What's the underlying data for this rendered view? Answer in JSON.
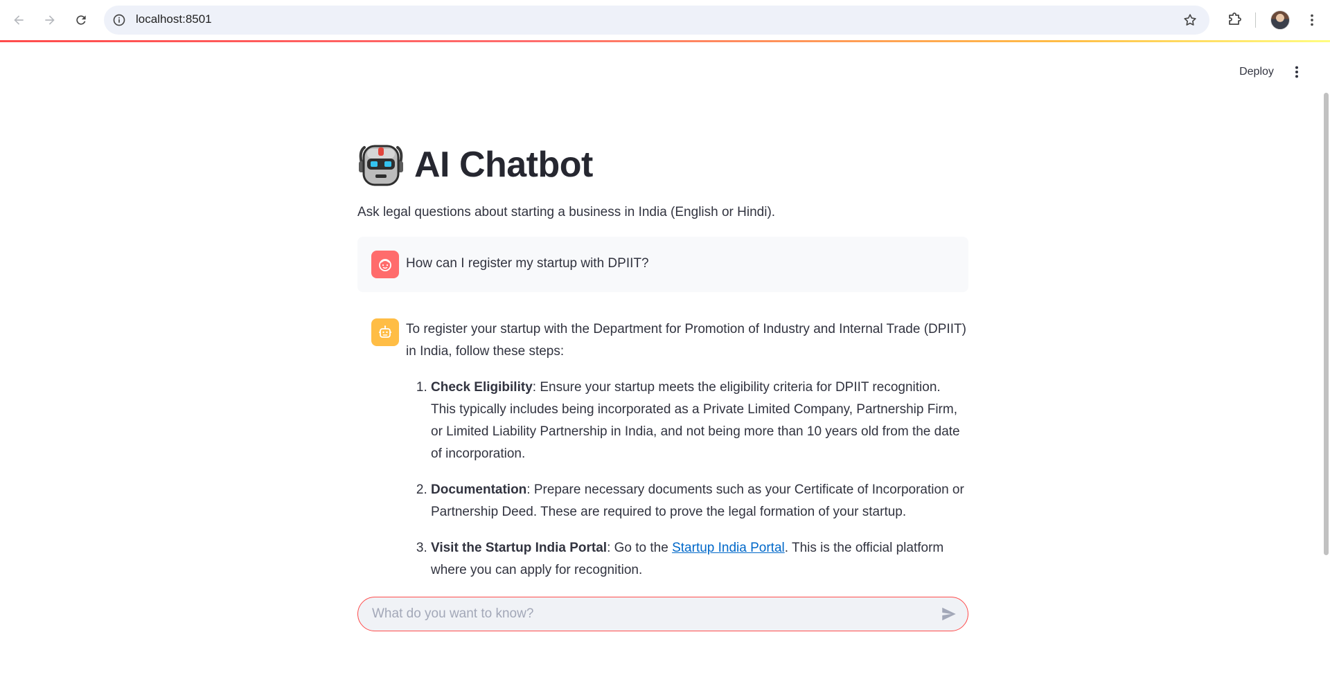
{
  "browser": {
    "url": "localhost:8501"
  },
  "header": {
    "deploy_label": "Deploy"
  },
  "app": {
    "title": "AI Chatbot",
    "subtitle": "Ask legal questions about starting a business in India (English or Hindi).",
    "title_icon": "robot-emoji"
  },
  "chat": {
    "user_message": "How can I register my startup with DPIIT?",
    "assistant": {
      "intro": "To register your startup with the Department for Promotion of Industry and Internal Trade (DPIIT) in India, follow these steps:",
      "steps": [
        {
          "number": "1.",
          "title": "Check Eligibility",
          "text": ": Ensure your startup meets the eligibility criteria for DPIIT recognition. This typically includes being incorporated as a Private Limited Company, Partnership Firm, or Limited Liability Partnership in India, and not being more than 10 years old from the date of incorporation."
        },
        {
          "number": "2.",
          "title": "Documentation",
          "text": ": Prepare necessary documents such as your Certificate of Incorporation or Partnership Deed. These are required to prove the legal formation of your startup."
        },
        {
          "number": "3.",
          "title": "Visit the Startup India Portal",
          "text_before": ": Go to the ",
          "link": "Startup India Portal",
          "text_after": ". This is the official platform where you can apply for recognition."
        }
      ]
    }
  },
  "input": {
    "placeholder": "What do you want to know?"
  },
  "colors": {
    "accent": "#ff4b4b",
    "user_avatar": "#ff6c6c",
    "bot_avatar": "#ffbd45",
    "link": "#0068c9"
  }
}
